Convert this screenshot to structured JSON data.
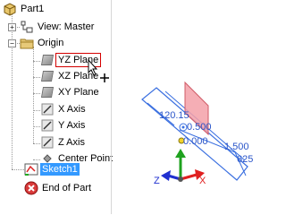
{
  "browser": {
    "root_label": "Part1",
    "view_label": "View: Master",
    "origin_label": "Origin",
    "origin_items": [
      {
        "label": "YZ Plane",
        "icon": "plane-icon"
      },
      {
        "label": "XZ Plane",
        "icon": "plane-icon"
      },
      {
        "label": "XY Plane",
        "icon": "plane-icon"
      },
      {
        "label": "X Axis",
        "icon": "axis-icon"
      },
      {
        "label": "Y Axis",
        "icon": "axis-icon"
      },
      {
        "label": "Z Axis",
        "icon": "axis-icon"
      },
      {
        "label": "Center Point",
        "icon": "center-point-icon"
      }
    ],
    "sketch_label": "Sketch1",
    "end_label": "End of Part"
  },
  "viewport": {
    "dimensions": [
      "120.15",
      "0.500",
      "0.000",
      "1.500",
      "625"
    ],
    "triad": {
      "x_label": "X",
      "y_label": "Y",
      "z_label": "Z"
    },
    "colors": {
      "sketch": "#3a6fe0",
      "highlight_plane": "#f3a0a8",
      "x_axis": "#e02020",
      "y_axis": "#1fa21f",
      "z_axis": "#2030d0"
    }
  }
}
